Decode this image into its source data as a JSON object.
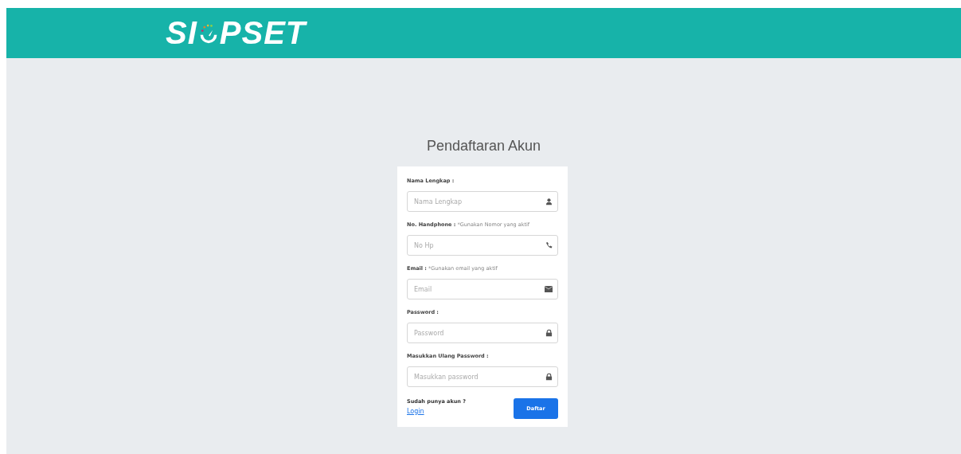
{
  "header": {
    "logo_start": "SI",
    "logo_end": "PSET"
  },
  "title": "Pendaftaran Akun",
  "fields": [
    {
      "kind": "name",
      "label": "Nama Lengkap :",
      "placeholder": "Nama Lengkap"
    },
    {
      "kind": "phone",
      "label": "No. Handphone :",
      "hint": "*Gunakan Nomor yang aktif",
      "placeholder": "No Hp"
    },
    {
      "kind": "email",
      "label": "Email :",
      "hint": "*Gunakan email yang aktif",
      "placeholder": "Email"
    },
    {
      "kind": "password",
      "label": "Password :",
      "placeholder": "Password"
    },
    {
      "kind": "password",
      "label": "Masukkan Ulang Password :",
      "placeholder": "Masukkan password"
    }
  ],
  "footer": {
    "question": "Sudah punya akun ?",
    "link": "Login",
    "button": "Daftar"
  }
}
